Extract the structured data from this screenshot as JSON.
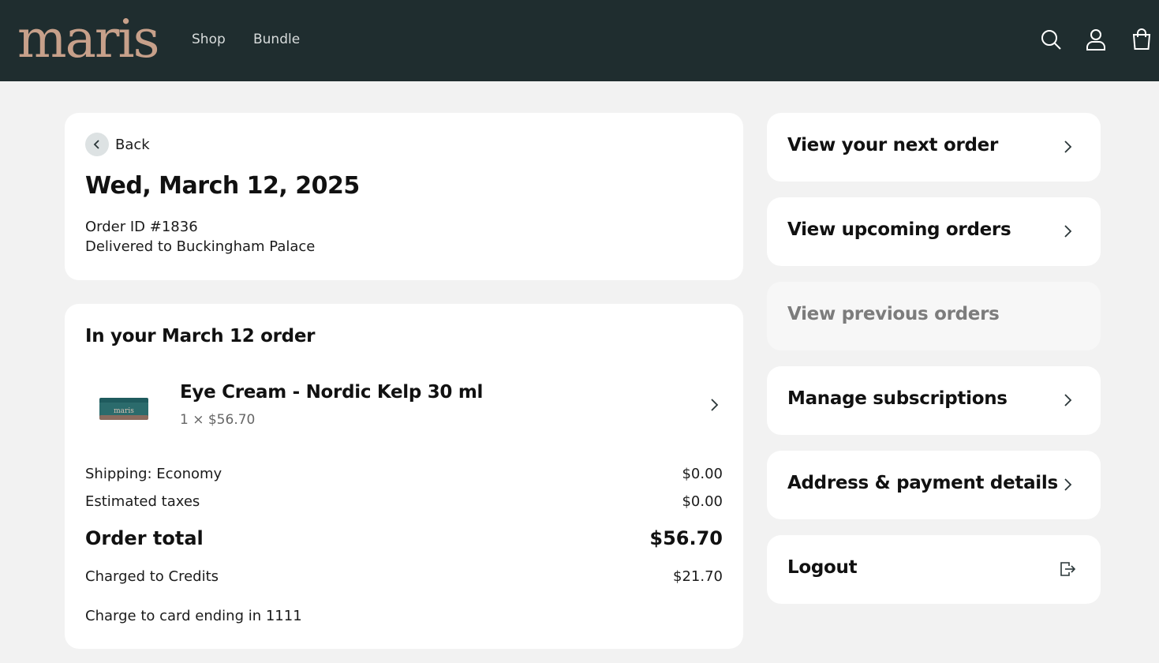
{
  "header": {
    "logo": "maris",
    "nav": [
      {
        "label": "Shop"
      },
      {
        "label": "Bundle"
      }
    ],
    "icons": [
      "search-icon",
      "account-icon",
      "cart-icon"
    ]
  },
  "order": {
    "back_label": "Back",
    "date": "Wed, March 12, 2025",
    "order_id": "Order ID #1836",
    "delivered_to": "Delivered to Buckingham Palace"
  },
  "items_section": {
    "title": "In your March 12 order",
    "items": [
      {
        "name": "Eye Cream - Nordic Kelp 30 ml",
        "qty_price": "1 × $56.70",
        "image_label": "maris"
      }
    ]
  },
  "summary": {
    "shipping_label": "Shipping: Economy",
    "shipping_value": "$0.00",
    "taxes_label": "Estimated taxes",
    "taxes_value": "$0.00",
    "total_label": "Order total",
    "total_value": "$56.70",
    "credits_label": "Charged to Credits",
    "credits_value": "$21.70",
    "card_note": "Charge to card ending in 1111"
  },
  "menu": {
    "items": [
      {
        "label": "View your next order",
        "icon": "chevron-right-icon"
      },
      {
        "label": "View upcoming orders",
        "icon": "chevron-right-icon"
      },
      {
        "label": "View previous orders",
        "icon": "none"
      },
      {
        "label": "Manage subscriptions",
        "icon": "chevron-right-icon"
      },
      {
        "label": "Address & payment details",
        "icon": "chevron-right-icon"
      },
      {
        "label": "Logout",
        "icon": "logout-icon"
      }
    ]
  },
  "colors": {
    "header_bg": "#1f2d2f",
    "logo": "#c7a08a",
    "page_bg": "#f2f2f2",
    "card_bg": "#ffffff",
    "muted_card_bg": "#f7f7f7",
    "text": "#111111",
    "muted_text": "#7c7c7c"
  }
}
